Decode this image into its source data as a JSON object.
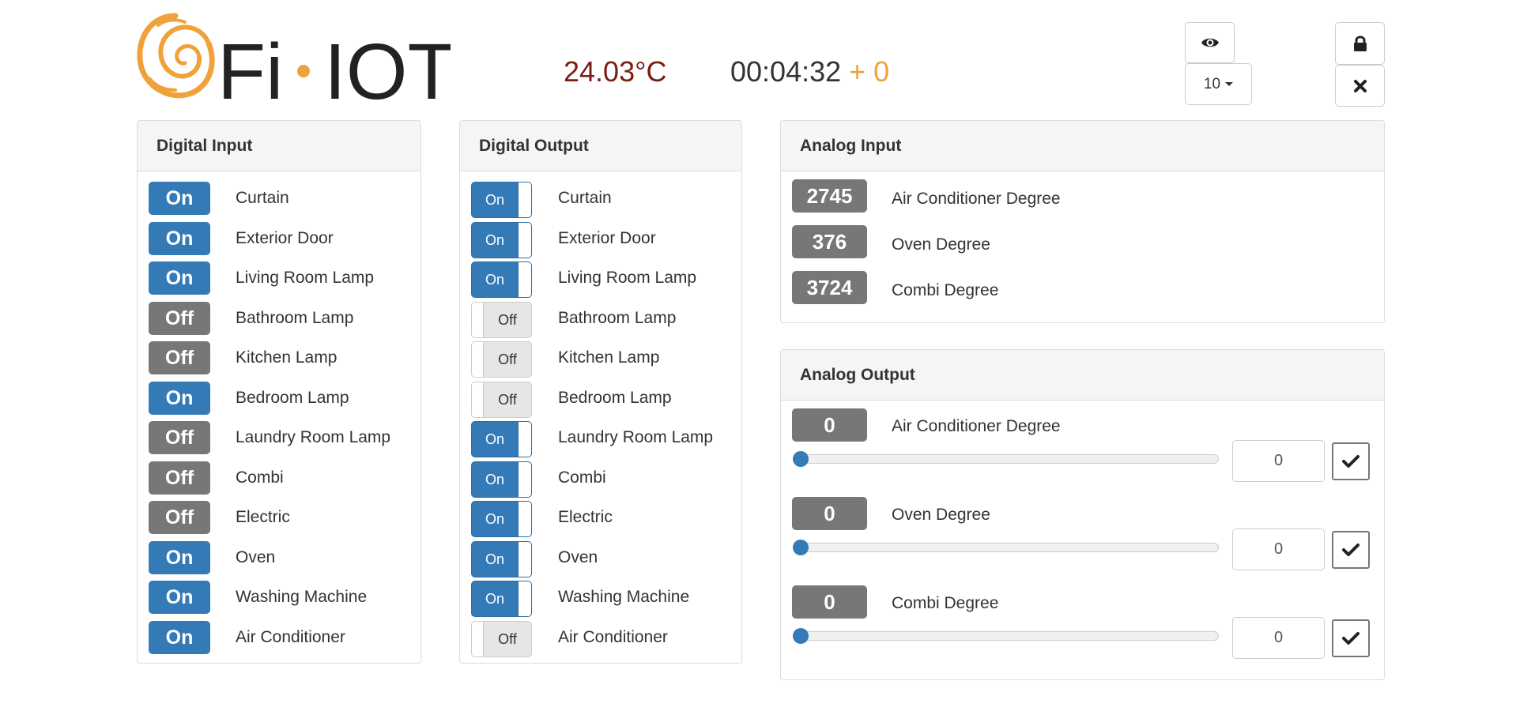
{
  "header": {
    "logo_text": "Fi • IOT",
    "temperature": "24.03°C",
    "clock": "00:04:32",
    "clock_delta": "+ 0",
    "view_icon": "eye-icon",
    "page_size_dropdown": {
      "selected": "10"
    },
    "lock_icon": "lock-icon",
    "close_icon": "close-icon"
  },
  "digital_input": {
    "title": "Digital Input",
    "items": [
      {
        "state": "On",
        "label": "Curtain"
      },
      {
        "state": "On",
        "label": "Exterior Door"
      },
      {
        "state": "On",
        "label": "Living Room Lamp"
      },
      {
        "state": "Off",
        "label": "Bathroom Lamp"
      },
      {
        "state": "Off",
        "label": "Kitchen Lamp"
      },
      {
        "state": "On",
        "label": "Bedroom Lamp"
      },
      {
        "state": "Off",
        "label": "Laundry Room Lamp"
      },
      {
        "state": "Off",
        "label": "Combi"
      },
      {
        "state": "Off",
        "label": "Electric"
      },
      {
        "state": "On",
        "label": "Oven"
      },
      {
        "state": "On",
        "label": "Washing Machine"
      },
      {
        "state": "On",
        "label": "Air Conditioner"
      }
    ]
  },
  "digital_output": {
    "title": "Digital Output",
    "items": [
      {
        "state": "On",
        "label": "Curtain"
      },
      {
        "state": "On",
        "label": "Exterior Door"
      },
      {
        "state": "On",
        "label": "Living Room Lamp"
      },
      {
        "state": "Off",
        "label": "Bathroom Lamp"
      },
      {
        "state": "Off",
        "label": "Kitchen Lamp"
      },
      {
        "state": "Off",
        "label": "Bedroom Lamp"
      },
      {
        "state": "On",
        "label": "Laundry Room Lamp"
      },
      {
        "state": "On",
        "label": "Combi"
      },
      {
        "state": "On",
        "label": "Electric"
      },
      {
        "state": "On",
        "label": "Oven"
      },
      {
        "state": "On",
        "label": "Washing Machine"
      },
      {
        "state": "Off",
        "label": "Air Conditioner"
      }
    ]
  },
  "analog_input": {
    "title": "Analog Input",
    "items": [
      {
        "value": "2745",
        "label": "Air Conditioner Degree"
      },
      {
        "value": "376",
        "label": "Oven Degree"
      },
      {
        "value": "3724",
        "label": "Combi Degree"
      }
    ]
  },
  "analog_output": {
    "title": "Analog Output",
    "items": [
      {
        "value": "0",
        "label": "Air Conditioner Degree",
        "slider_level": 0,
        "input_value": "0",
        "apply_icon": "check-icon"
      },
      {
        "value": "0",
        "label": "Oven Degree",
        "slider_level": 0,
        "input_value": "0",
        "apply_icon": "check-icon"
      },
      {
        "value": "0",
        "label": "Combi Degree",
        "slider_level": 0,
        "input_value": "0",
        "apply_icon": "check-icon"
      }
    ]
  },
  "colors": {
    "primary": "#337ab7",
    "off_gray": "#777777",
    "temperature": "#7a1d12",
    "accent_orange": "#f0a23a"
  }
}
